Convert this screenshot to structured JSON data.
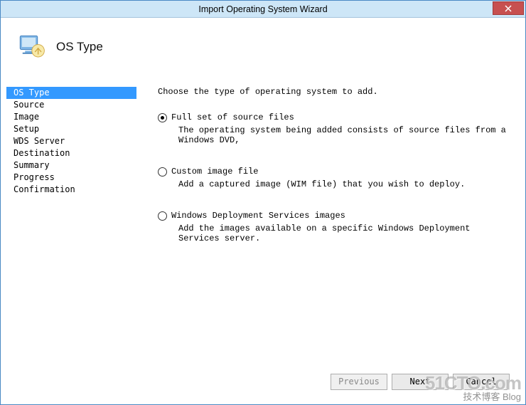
{
  "window": {
    "title": "Import Operating System Wizard"
  },
  "header": {
    "page_title": "OS Type"
  },
  "sidebar": {
    "items": [
      {
        "label": "OS Type",
        "active": true
      },
      {
        "label": "Source",
        "active": false
      },
      {
        "label": "Image",
        "active": false
      },
      {
        "label": "Setup",
        "active": false
      },
      {
        "label": "WDS Server",
        "active": false
      },
      {
        "label": "Destination",
        "active": false
      },
      {
        "label": "Summary",
        "active": false
      },
      {
        "label": "Progress",
        "active": false
      },
      {
        "label": "Confirmation",
        "active": false
      }
    ]
  },
  "main": {
    "instruction": "Choose the type of operating system to add.",
    "options": [
      {
        "label": "Full set of source files",
        "description": "The operating system being added consists of source files from a Windows DVD,",
        "checked": true
      },
      {
        "label": "Custom image file",
        "description": "Add a captured image (WIM file) that you wish to deploy.",
        "checked": false
      },
      {
        "label": "Windows Deployment Services images",
        "description": "Add the images available on a specific Windows Deployment Services server.",
        "checked": false
      }
    ]
  },
  "buttons": {
    "previous": "Previous",
    "next": "Next",
    "cancel": "Cancel"
  },
  "watermark": {
    "big": "51CTO.com",
    "small": "技术博客 Blog"
  }
}
